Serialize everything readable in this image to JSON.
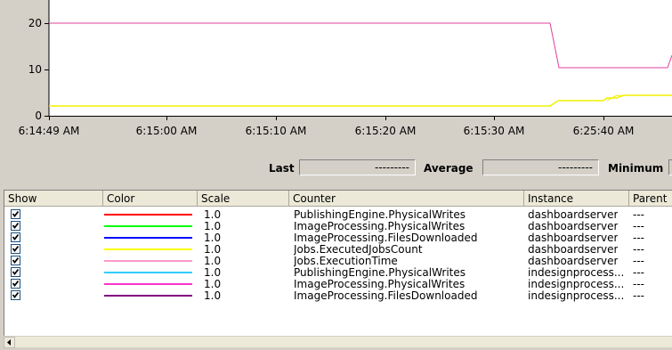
{
  "graph": {
    "y_ticks": [
      "20",
      "10",
      "0"
    ],
    "x_ticks": [
      "6:14:49 AM",
      "6:15:00 AM",
      "6:15:10 AM",
      "6:15:20 AM",
      "6:15:30 AM",
      "6:25:40 AM"
    ],
    "series_colors": {
      "pink_line": "#e0409c",
      "yellow_line": "#f0f000"
    }
  },
  "value_bar": {
    "last_label": "Last",
    "last_value": "---------",
    "average_label": "Average",
    "average_value": "---------",
    "minimum_label": "Minimum"
  },
  "list": {
    "columns": [
      "Show",
      "Color",
      "Scale",
      "Counter",
      "Instance",
      "Parent"
    ],
    "rows": [
      {
        "show": true,
        "color": "#ff0000",
        "scale": "1.0",
        "counter": "PublishingEngine.PhysicalWrites",
        "instance": "dashboardserver",
        "parent": "---"
      },
      {
        "show": true,
        "color": "#00ff00",
        "scale": "1.0",
        "counter": "ImageProcessing.PhysicalWrites",
        "instance": "dashboardserver",
        "parent": "---"
      },
      {
        "show": true,
        "color": "#0000ff",
        "scale": "1.0",
        "counter": "ImageProcessing.FilesDownloaded",
        "instance": "dashboardserver",
        "parent": "---"
      },
      {
        "show": true,
        "color": "#ffff00",
        "scale": "1.0",
        "counter": "Jobs.ExecutedJobsCount",
        "instance": "dashboardserver",
        "parent": "---"
      },
      {
        "show": true,
        "color": "#ff99cc",
        "scale": "1.0",
        "counter": "Jobs.ExecutionTime",
        "instance": "dashboardserver",
        "parent": "---"
      },
      {
        "show": true,
        "color": "#33ccff",
        "scale": "1.0",
        "counter": "PublishingEngine.PhysicalWrites",
        "instance": "indesignprocess...",
        "parent": "---"
      },
      {
        "show": true,
        "color": "#ff33cc",
        "scale": "1.0",
        "counter": "ImageProcessing.PhysicalWrites",
        "instance": "indesignprocess...",
        "parent": "---"
      },
      {
        "show": true,
        "color": "#800080",
        "scale": "1.0",
        "counter": "ImageProcessing.FilesDownloaded",
        "instance": "indesignprocess...",
        "parent": "---"
      }
    ]
  }
}
